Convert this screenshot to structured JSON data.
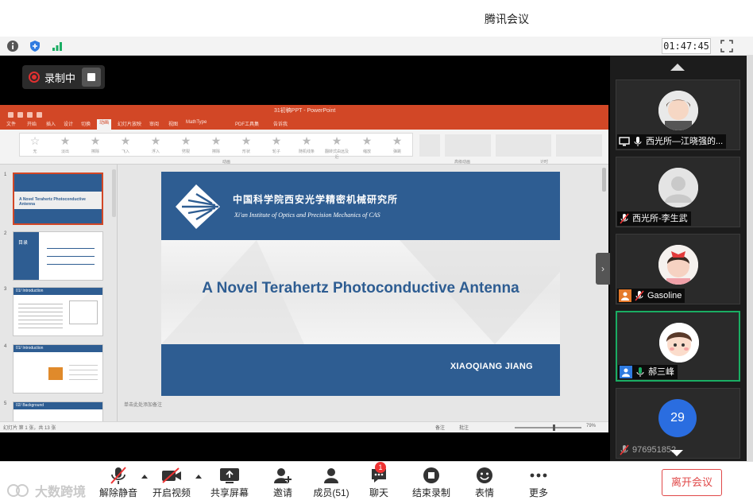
{
  "window": {
    "title": "腾讯会议"
  },
  "infobar": {
    "timer": "01:47:45"
  },
  "recording": {
    "label": "录制中"
  },
  "ppt": {
    "doc_title": "31初稿PPT - PowerPoint",
    "tabs": [
      "文件",
      "开始",
      "插入",
      "设计",
      "切换",
      "动画",
      "幻灯片放映",
      "审阅",
      "视图",
      "MathType",
      "PDF工具集",
      "告诉我"
    ],
    "active_tab_index": 4,
    "gallery": [
      "无",
      "淡出",
      "擦除",
      "飞入",
      "浮入",
      "劈裂",
      "擦除",
      "形状",
      "轮子",
      "随机线条",
      "翻转式由远及近",
      "缩放",
      "弹跳"
    ],
    "ribbon_group_label": "动画",
    "ribbon_group2_label": "高级动画",
    "ribbon_group3_label": "计时",
    "thumbnails": [
      {
        "num": "1",
        "title": "A Novel Terahertz Photoconductive Antenna"
      },
      {
        "num": "2",
        "title": "目录"
      },
      {
        "num": "3",
        "title": "01/ Introduction"
      },
      {
        "num": "4",
        "title": "01/ Introduction"
      },
      {
        "num": "5",
        "title": "02/ Background"
      }
    ],
    "slide": {
      "org_cn": "中国科学院西安光学精密机械研究所",
      "org_en": "Xi'an Institute of Optics and Precision Mechanics of CAS",
      "title": "A Novel Terahertz Photoconductive Antenna",
      "author": "XIAOQIANG JIANG"
    },
    "notes_placeholder": "单击此处添加备注",
    "status_left": "幻灯片 第 1 张，共 13 张",
    "status_notes": "备注",
    "status_comments": "批注",
    "zoom": "79%"
  },
  "participants": [
    {
      "name": "西光所—江晓强的...",
      "kind": "avatar-girl"
    },
    {
      "name": "西光所-李生武",
      "kind": "avatar-default"
    },
    {
      "name": "Gasoline",
      "kind": "avatar-child"
    },
    {
      "name": "郝三峰",
      "kind": "avatar-baby"
    },
    {
      "name": "976951852",
      "kind": "count",
      "count": "29"
    }
  ],
  "toolbar": {
    "mute": "解除静音",
    "video": "开启视频",
    "share": "共享屏幕",
    "invite": "邀请",
    "members": "成员(51)",
    "chat": "聊天",
    "chat_badge": "1",
    "stop_record": "结束录制",
    "emoji": "表情",
    "more": "更多",
    "leave": "离开会议"
  },
  "watermark": "大数跨境",
  "colors": {
    "ppt_orange": "#d24726",
    "slide_blue": "#2e5d92",
    "leave_red": "#e04848",
    "active_green": "#1aad63"
  }
}
